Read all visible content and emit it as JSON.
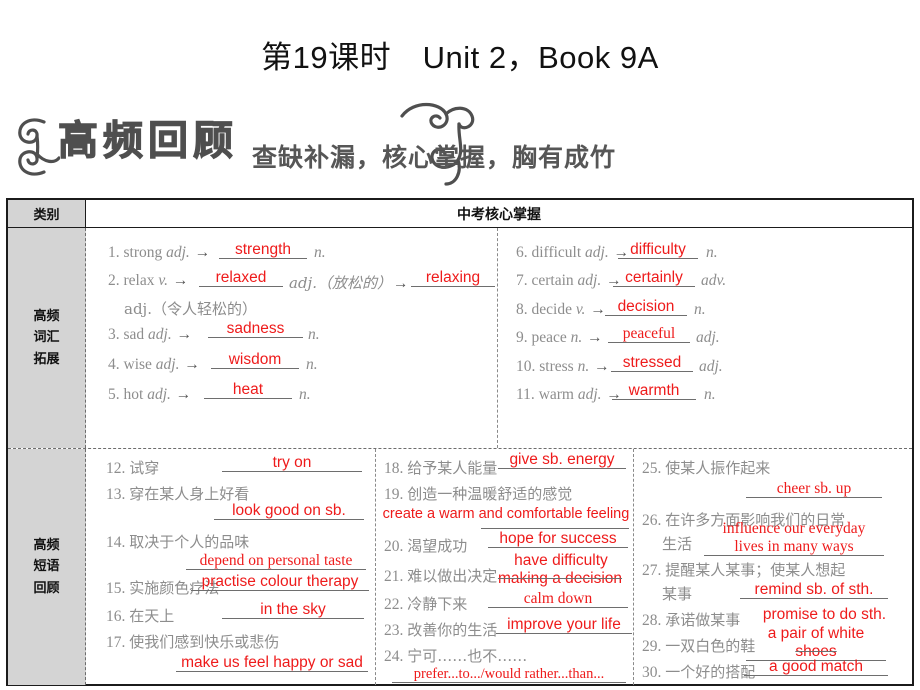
{
  "page": {
    "title": "第19课时　Unit 2，Book 9A",
    "banner_title": "高频回顾",
    "banner_subtitle": "查缺补漏，核心掌握，胸有成竹",
    "accent_color": "#ee1b1b",
    "label_bg": "#d4d4d4",
    "text_gray": "#8d8d8d"
  },
  "table": {
    "header": {
      "category_label": "类别",
      "main_label": "中考核心掌握"
    },
    "sections": [
      {
        "label": "高频词汇拓展",
        "label_lines": [
          "高频",
          "词汇",
          "拓展"
        ],
        "columns": [
          {
            "entries": [
              {
                "num": "1.",
                "stem": "strong",
                "pos": "adj.",
                "answer": "strength",
                "tail_pos": "n."
              },
              {
                "num": "2.",
                "stem": "relax",
                "pos": "v.",
                "answer": "relaxed",
                "mid": "adj.（放松的）",
                "answer2": "relaxing",
                "tail_zh": "adj.（令人轻松的）"
              },
              {
                "num": "3.",
                "stem": "sad",
                "pos": "adj.",
                "answer": "sadness",
                "tail_pos": "n."
              },
              {
                "num": "4.",
                "stem": "wise",
                "pos": "adj.",
                "answer": "wisdom",
                "tail_pos": "n."
              },
              {
                "num": "5.",
                "stem": "hot",
                "pos": "adj.",
                "answer": "heat",
                "tail_pos": "n."
              }
            ]
          },
          {
            "entries": [
              {
                "num": "6.",
                "stem": "difficult",
                "pos": "adj.",
                "answer": "difficulty",
                "tail_pos": "n."
              },
              {
                "num": "7.",
                "stem": "certain",
                "pos": "adj.",
                "answer": "certainly",
                "tail_pos": "adv."
              },
              {
                "num": "8.",
                "stem": "decide",
                "pos": "v.",
                "answer": "decision",
                "tail_pos": "n."
              },
              {
                "num": "9.",
                "stem": "peace",
                "pos": "n.",
                "answer": "peaceful",
                "tail_pos": "adj."
              },
              {
                "num": "10.",
                "stem": "stress",
                "pos": "n.",
                "answer": "stressed",
                "tail_pos": "adj."
              },
              {
                "num": "11.",
                "stem": "warm",
                "pos": "adj.",
                "answer": "warmth",
                "tail_pos": "n."
              }
            ]
          }
        ]
      },
      {
        "label": "高频短语回顾",
        "label_lines": [
          "高频",
          "短语",
          "回顾"
        ],
        "columns": [
          {
            "entries": [
              {
                "num": "12.",
                "zh": "试穿",
                "answer": "try on"
              },
              {
                "num": "13.",
                "zh": "穿在某人身上好看",
                "answer": "look good on sb."
              },
              {
                "num": "14.",
                "zh": "取决于个人的品味",
                "answer": "depend on personal taste"
              },
              {
                "num": "15.",
                "zh": "实施颜色疗法",
                "answer": "practise colour therapy"
              },
              {
                "num": "16.",
                "zh": "在天上",
                "answer": "in the sky"
              },
              {
                "num": "17.",
                "zh": "使我们感到快乐或悲伤",
                "answer": "make us feel happy or sad"
              }
            ]
          },
          {
            "entries": [
              {
                "num": "18.",
                "zh": "给予某人能量",
                "answer": "give sb. energy"
              },
              {
                "num": "19.",
                "zh": "创造一种温暖舒适的感觉",
                "answer": "create a warm and comfortable feeling"
              },
              {
                "num": "20.",
                "zh": "渴望成功",
                "answer": "hope for success"
              },
              {
                "num": "21.",
                "zh": "难以做出决定",
                "answer": "have difficulty",
                "answer_line2": "making a decision"
              },
              {
                "num": "22.",
                "zh": "冷静下来",
                "answer": "calm down"
              },
              {
                "num": "23.",
                "zh": "改善你的生活",
                "answer": "improve your life"
              },
              {
                "num": "24.",
                "zh": "宁可……也不……",
                "answer": "prefer...to.../would rather...than..."
              }
            ]
          },
          {
            "entries": [
              {
                "num": "25.",
                "zh": "使某人振作起来",
                "answer": "cheer sb. up"
              },
              {
                "num": "26.",
                "zh": "在许多方面影响我们的日常",
                "zh_line2": "生活",
                "answer": "influence our everyday",
                "answer_line2": "lives in many ways"
              },
              {
                "num": "27.",
                "zh": "提醒某人某事；使某人想起",
                "zh_line2": "某事",
                "answer": "remind sb. of sth."
              },
              {
                "num": "28.",
                "zh": "承诺做某事",
                "answer": "promise to do sth."
              },
              {
                "num": "29.",
                "zh": "一双白色的鞋",
                "answer": "a pair of white",
                "answer_line2": "shoes"
              },
              {
                "num": "30.",
                "zh": "一个好的搭配",
                "answer": "a good match"
              }
            ]
          }
        ]
      }
    ]
  }
}
